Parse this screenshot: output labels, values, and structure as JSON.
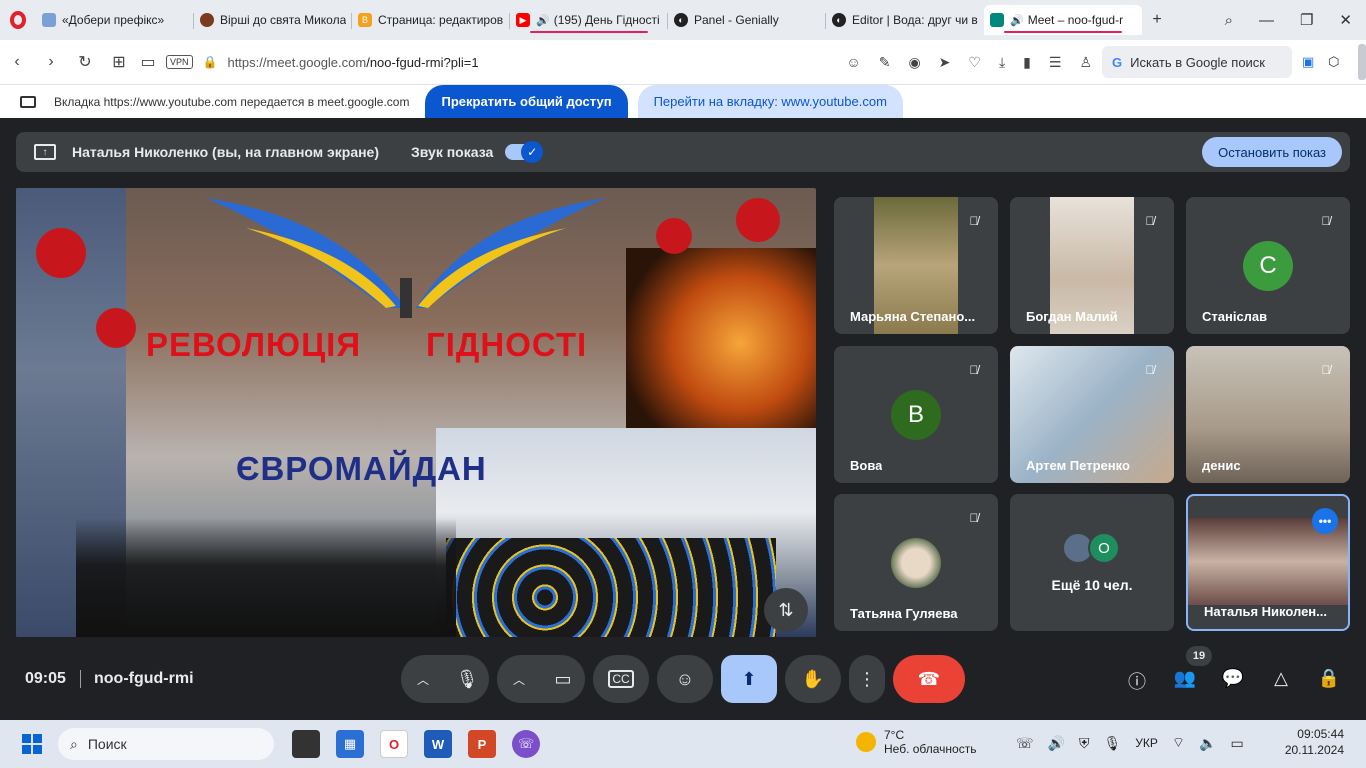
{
  "browser": {
    "tabs": [
      {
        "title": "«Добери префікс»",
        "fav_color": "#7aa0d6",
        "active": false
      },
      {
        "title": "Вірші до свята Микола",
        "fav_color": "#7a3b1e",
        "active": false
      },
      {
        "title": "Страница: редактиров",
        "fav_color": "#f4a21d",
        "active": false
      },
      {
        "title": "(195) День Гідності",
        "fav_color": "#ff0000",
        "active": false,
        "audio": true
      },
      {
        "title": "Panel - Genially",
        "fav_color": "#222222",
        "active": false
      },
      {
        "title": "Editor | Вода: друг чи в",
        "fav_color": "#222222",
        "active": false
      },
      {
        "title": "Meet – noo-fgud-r",
        "fav_color": "#00897b",
        "active": true,
        "audio": true
      }
    ],
    "new_tab": "+",
    "url_host": "https://meet.google.com",
    "url_path": "/noo-fgud-rmi?pli=1",
    "vpn_label": "VPN",
    "search_box": "Искать в Google поиск",
    "share_notice": "Вкладка https://www.youtube.com передается в meet.google.com",
    "stop_sharing": "Прекратить общий доступ",
    "go_to_tab": "Перейти на вкладку: www.youtube.com"
  },
  "presentation": {
    "presenter": "Наталья Николенко (вы, на главном экране)",
    "sound_label": "Звук показа",
    "stop_button": "Остановить показ",
    "sound_enabled": true
  },
  "slide": {
    "title_word1": "РЕВОЛЮЦІЯ",
    "title_word2": "ГІДНОСТІ",
    "subtitle": "ЄВРОМАЙДАН"
  },
  "participants": [
    {
      "name": "Марьяна Степано...",
      "muted": true,
      "type": "video",
      "video_color": "#8a7a4e"
    },
    {
      "name": "Богдан Малий",
      "muted": true,
      "type": "video",
      "video_color": "#c9b9a6"
    },
    {
      "name": "Станіслав",
      "muted": true,
      "type": "avatar",
      "initial": "С",
      "avatar_color": "#3b9b3d"
    },
    {
      "name": "Вова",
      "muted": true,
      "type": "avatar",
      "initial": "В",
      "avatar_color": "#2e6b1f"
    },
    {
      "name": "Артем Петренко",
      "muted": true,
      "type": "video",
      "video_color": "#9bb3c7"
    },
    {
      "name": "денис",
      "muted": true,
      "type": "video",
      "video_color": "#a89a8a"
    },
    {
      "name": "Татьяна Гуляева",
      "muted": true,
      "type": "photo",
      "avatar_color": "#6b7a5a"
    },
    {
      "name": "Наталья Николен...",
      "muted": false,
      "type": "video",
      "video_color": "#6d4e4a",
      "self": true
    }
  ],
  "more_participants": {
    "label": "Ещё 10 чел.",
    "initial": "О",
    "avatar_color": "#1e8e5e"
  },
  "meeting": {
    "time": "09:05",
    "code": "noo-fgud-rmi",
    "participant_count": "19"
  },
  "taskbar": {
    "search_label": "Поиск",
    "temperature": "7°C",
    "weather": "Неб. облачность",
    "language": "УКР",
    "clock_time": "09:05:44",
    "clock_date": "20.11.2024"
  }
}
